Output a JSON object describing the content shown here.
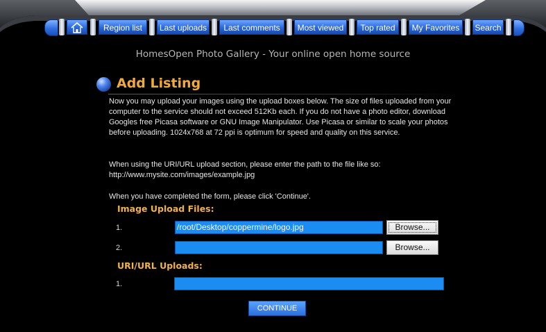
{
  "nav": {
    "items": [
      {
        "label": "Region list"
      },
      {
        "label": "Last uploads"
      },
      {
        "label": "Last comments"
      },
      {
        "label": "Most viewed"
      },
      {
        "label": "Top rated"
      },
      {
        "label": "My Favorites"
      },
      {
        "label": "Search"
      }
    ],
    "home_icon": "home-icon"
  },
  "header": {
    "tagline": "HomesOpen Photo Gallery - Your online open home source"
  },
  "main": {
    "title": "Add Listing",
    "intro": "Now you may upload your images using the upload boxes below. The size of files uploaded from your computer to the service should not exceed 512Kb each. If you do not have a photo editor, download Googles free Picasa software or GNU Image Manipulator. Use Picasa or similar to scale your photos before uploading. 1024x768 at 72 ppi is optimum for speed and quality on this service.",
    "uri_instructions": "When using the URI/URL upload section, please enter the path to the file like so: http://www.mysite.com/images/example.jpg",
    "continue_note": "When you have completed the form, please click 'Continue'.",
    "image_upload_label": "Image Upload Files:",
    "uri_upload_label": "URI/URL Uploads:",
    "file_rows": [
      {
        "num": "1.",
        "value": "/root/Desktop/coppermine/logo.jpg",
        "browse": "Browse..."
      },
      {
        "num": "2.",
        "value": "",
        "browse": "Browse..."
      }
    ],
    "uri_rows": [
      {
        "num": "1.",
        "value": ""
      }
    ],
    "continue_label": "CONTINUE"
  },
  "colors": {
    "accent_orange": "#f2a93b",
    "field_blue": "#1b8cf2",
    "nav_blue": "#2a68db"
  }
}
